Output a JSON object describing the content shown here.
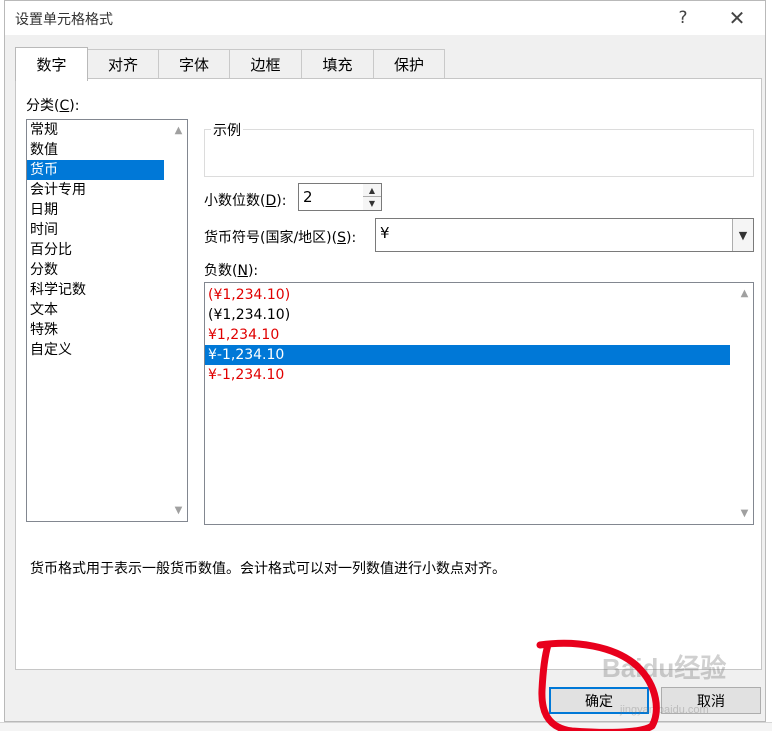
{
  "dialog": {
    "title": "设置单元格格式",
    "help_icon": "?",
    "close_icon": "✕"
  },
  "tabs": [
    {
      "label": "数字",
      "active": true
    },
    {
      "label": "对齐"
    },
    {
      "label": "字体"
    },
    {
      "label": "边框"
    },
    {
      "label": "填充"
    },
    {
      "label": "保护"
    }
  ],
  "category": {
    "label": "分类(",
    "label_key": "C",
    "label_end": "):",
    "items": [
      "常规",
      "数值",
      "货币",
      "会计专用",
      "日期",
      "时间",
      "百分比",
      "分数",
      "科学记数",
      "文本",
      "特殊",
      "自定义"
    ],
    "selected": "货币"
  },
  "sample": {
    "legend": "示例",
    "value": ""
  },
  "decimals": {
    "label": "小数位数(",
    "label_key": "D",
    "label_end": "):",
    "value": "2"
  },
  "symbol": {
    "label": "货币符号(国家/地区)(",
    "label_key": "S",
    "label_end": "):",
    "value": "¥"
  },
  "negative": {
    "label": "负数(",
    "label_key": "N",
    "label_end": "):",
    "items": [
      {
        "text": "(¥1,234.10)",
        "color": "#e00000"
      },
      {
        "text": "(¥1,234.10)",
        "color": "#000000"
      },
      {
        "text": "¥1,234.10",
        "color": "#e00000"
      },
      {
        "text": "¥-1,234.10",
        "color": "#000000",
        "selected": true
      },
      {
        "text": "¥-1,234.10",
        "color": "#e00000"
      }
    ]
  },
  "description": "货币格式用于表示一般货币数值。会计格式可以对一列数值进行小数点对齐。",
  "buttons": {
    "ok": "确定",
    "cancel": "取消"
  },
  "watermark": {
    "brand": "Baidu经验",
    "url": "jingyan.baidu.com"
  },
  "colors": {
    "accent": "#0078d7",
    "negative_red": "#e00000",
    "annotation": "#e8001c"
  }
}
